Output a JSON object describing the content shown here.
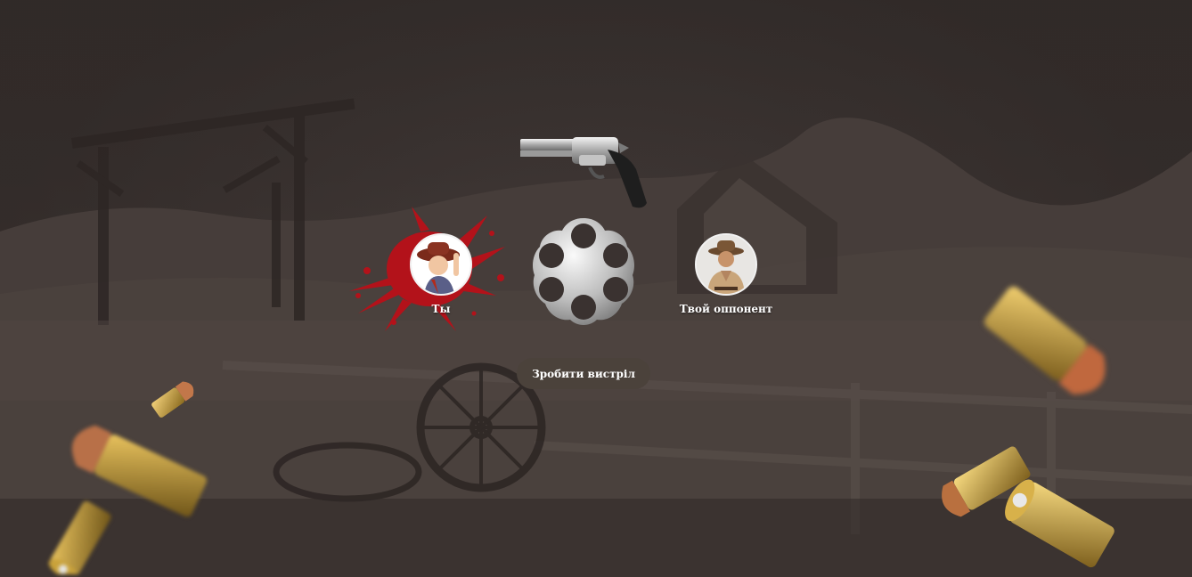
{
  "players": {
    "you": {
      "label": "Ты"
    },
    "opponent": {
      "label": "Твой оппонент"
    }
  },
  "actions": {
    "shoot_label": "Зробити вистріл"
  },
  "icons": {
    "revolver": "revolver-icon",
    "cylinder": "revolver-cylinder-icon",
    "bullet": "bullet-icon",
    "blood": "blood-splatter"
  },
  "colors": {
    "background": "#3a3230",
    "blood": "#b3121a",
    "button": "#4b423b",
    "text": "#ffffff",
    "brass": "#c9a23a",
    "copper": "#b8683a"
  }
}
